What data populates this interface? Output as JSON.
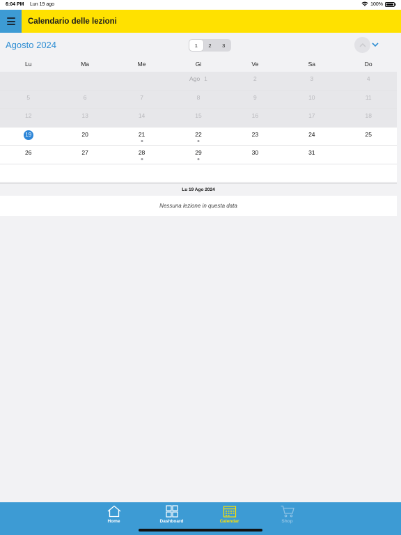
{
  "status_bar": {
    "time": "6:04 PM",
    "date": "Lun 19 ago",
    "battery": "100%"
  },
  "app_bar": {
    "title": "Calendario delle lezioni"
  },
  "calendar": {
    "month_title": "Agosto 2024",
    "segments": [
      "1",
      "2",
      "3"
    ],
    "active_segment": "1",
    "weekdays": [
      "Lu",
      "Ma",
      "Me",
      "Gi",
      "Ve",
      "Sa",
      "Do"
    ],
    "month_tag": "Ago",
    "weeks": [
      [
        "",
        "",
        "",
        "1",
        "2",
        "3",
        "4"
      ],
      [
        "5",
        "6",
        "7",
        "8",
        "9",
        "10",
        "11"
      ],
      [
        "12",
        "13",
        "14",
        "15",
        "16",
        "17",
        "18"
      ],
      [
        "19",
        "20",
        "21",
        "22",
        "23",
        "24",
        "25"
      ],
      [
        "26",
        "27",
        "28",
        "29",
        "30",
        "31",
        ""
      ]
    ],
    "today": "19",
    "days_with_dot": [
      "21",
      "22",
      "28",
      "29"
    ]
  },
  "selected_date": {
    "header": "Lu 19 Ago 2024",
    "empty_message": "Nessuna lezione in questa data"
  },
  "tab_bar": {
    "tabs": [
      {
        "label": "Home",
        "icon": "home-icon",
        "state": "normal"
      },
      {
        "label": "Dashboard",
        "icon": "dashboard-icon",
        "state": "normal"
      },
      {
        "label": "Calendar",
        "icon": "calendar-icon",
        "state": "active"
      },
      {
        "label": "Shop",
        "icon": "cart-icon",
        "state": "disabled"
      }
    ]
  },
  "colors": {
    "accent_yellow": "#ffe100",
    "accent_blue": "#3d9bd4",
    "today_blue": "#2d86d8",
    "month_title_blue": "#2f8ed3"
  }
}
